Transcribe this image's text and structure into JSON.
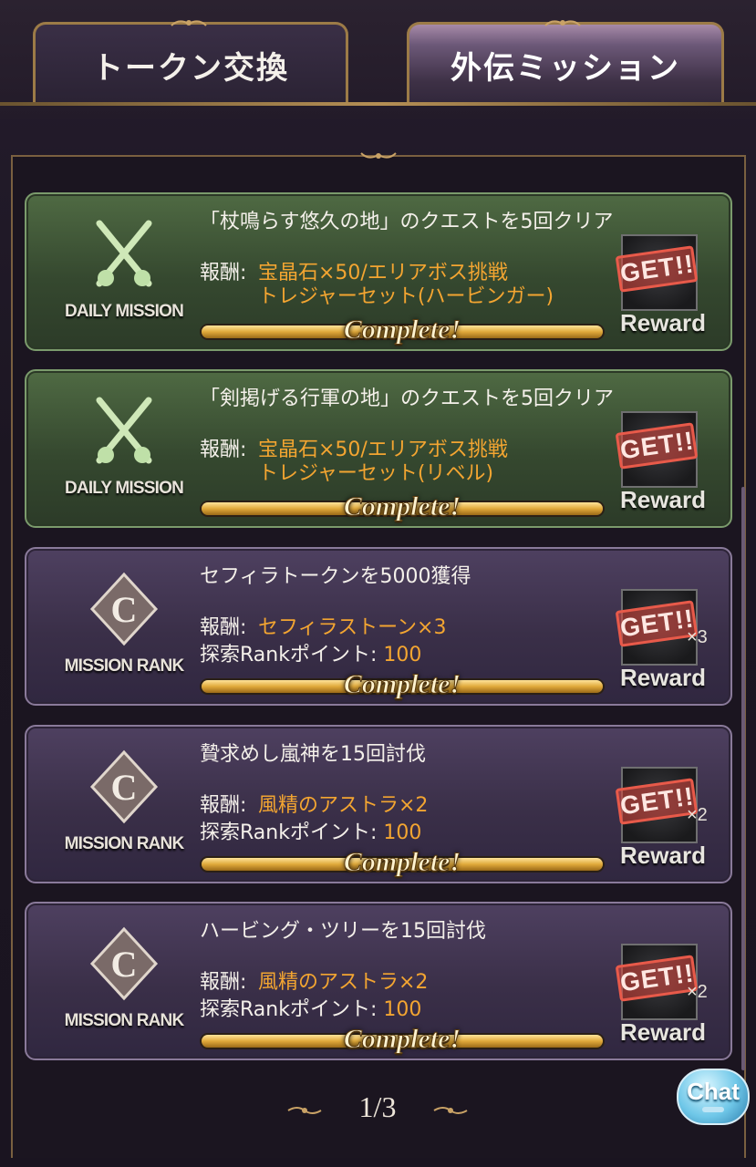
{
  "tabs": [
    {
      "label": "トークン交換",
      "active": false
    },
    {
      "label": "外伝ミッション",
      "active": true
    }
  ],
  "labels": {
    "reward_prefix": "報酬:",
    "rank_points_prefix": "探索Rankポイント:",
    "complete": "Complete!",
    "get": "GET!!",
    "reward": "Reward"
  },
  "missions": [
    {
      "type": "daily",
      "badge_label": "DAILY MISSION",
      "title": "「杖鳴らす悠久の地」のクエストを5回クリア",
      "reward_line1": "宝晶石×50/エリアボス挑戦",
      "reward_line2": "トレジャーセット(ハービンガー)",
      "quantity": ""
    },
    {
      "type": "daily",
      "badge_label": "DAILY MISSION",
      "title": "「剣掲げる行軍の地」のクエストを5回クリア",
      "reward_line1": "宝晶石×50/エリアボス挑戦",
      "reward_line2": "トレジャーセット(リベル)",
      "quantity": ""
    },
    {
      "type": "rank",
      "badge_label": "MISSION RANK",
      "title": "セフィラトークンを5000獲得",
      "reward_line1": "セフィラストーン×3",
      "rank_points": "100",
      "quantity": "×3"
    },
    {
      "type": "rank",
      "badge_label": "MISSION RANK",
      "title": "贄求めし嵐神を15回討伐",
      "reward_line1": "風精のアストラ×2",
      "rank_points": "100",
      "quantity": "×2"
    },
    {
      "type": "rank",
      "badge_label": "MISSION RANK",
      "title": "ハービング・ツリーを15回討伐",
      "reward_line1": "風精のアストラ×2",
      "rank_points": "100",
      "quantity": "×2"
    }
  ],
  "pager": {
    "text": "1/3"
  },
  "chat": {
    "label": "Chat"
  },
  "colors": {
    "accent_orange": "#f3a531",
    "daily_bg": "#3f5537",
    "rank_bg": "#3a2f48",
    "gold": "#c9a266"
  }
}
